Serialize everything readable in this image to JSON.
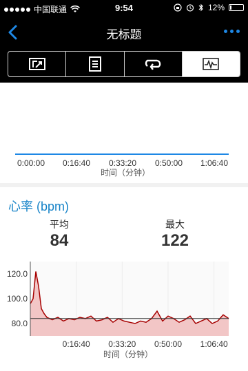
{
  "status_bar": {
    "carrier": "中国联通",
    "time": "9:54",
    "battery": "12%",
    "battery_level": 0.12
  },
  "nav": {
    "title": "无标题"
  },
  "tabs": [
    {
      "icon": "map-icon",
      "active": false
    },
    {
      "icon": "list-icon",
      "active": false
    },
    {
      "icon": "laps-icon",
      "active": false
    },
    {
      "icon": "chart-icon",
      "active": true
    }
  ],
  "chart_top": {
    "x_ticks": [
      "0:00:00",
      "0:16:40",
      "0:33:20",
      "0:50:00",
      "1:06:40"
    ],
    "xlabel": "时间（分钟）",
    "line_color": "#1e88e5"
  },
  "heart_rate": {
    "title": "心率 (bpm)",
    "avg_label": "平均",
    "avg_value": "84",
    "max_label": "最大",
    "max_value": "122",
    "line_color": "#a60000",
    "fill_color": "#f2c6c6"
  },
  "chart_data": {
    "type": "line",
    "xlabel": "时间（分钟）",
    "ylabel": "",
    "x_ticks": [
      "0:16:40",
      "0:33:20",
      "0:50:00",
      "1:06:40"
    ],
    "y_ticks": [
      "80.0",
      "100.0",
      "120.0"
    ],
    "ylim": [
      70,
      130
    ],
    "average": 84,
    "series": [
      {
        "x": [
          "0:00:00",
          "0:01:00",
          "0:02:00",
          "0:03:00",
          "0:04:00",
          "0:05:00",
          "0:06:00",
          "0:07:00",
          "0:08:00",
          "0:10:00",
          "0:12:00",
          "0:14:00",
          "0:16:00",
          "0:18:00",
          "0:20:00",
          "0:22:00",
          "0:24:00",
          "0:26:00",
          "0:28:00",
          "0:30:00",
          "0:32:00",
          "0:34:00",
          "0:36:00",
          "0:38:00",
          "0:40:00",
          "0:42:00",
          "0:44:00",
          "0:46:00",
          "0:48:00",
          "0:50:00",
          "0:52:00",
          "0:54:00",
          "0:56:00",
          "0:58:00",
          "1:00:00",
          "1:02:00",
          "1:04:00",
          "1:06:00",
          "1:08:00",
          "1:10:00",
          "1:12:00"
        ],
        "values": [
          96,
          100,
          122,
          110,
          92,
          88,
          85,
          84,
          83,
          85,
          82,
          84,
          83,
          85,
          84,
          86,
          82,
          83,
          85,
          81,
          84,
          82,
          81,
          80,
          82,
          81,
          84,
          90,
          82,
          86,
          84,
          81,
          83,
          86,
          80,
          82,
          84,
          80,
          82,
          87,
          84
        ]
      }
    ]
  }
}
